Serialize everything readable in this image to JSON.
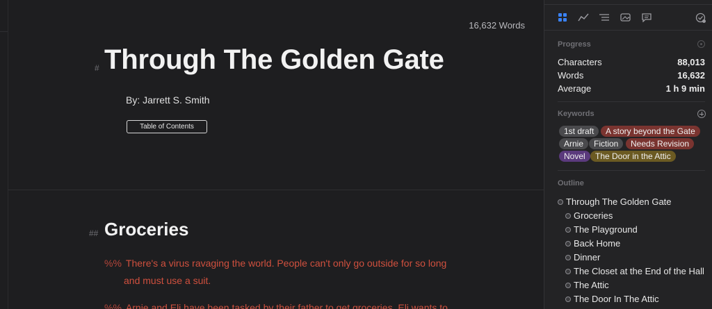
{
  "editor": {
    "word_count": "16,632 Words",
    "h1_marker": "#",
    "title": "Through The Golden Gate",
    "byline": "By: Jarrett S. Smith",
    "toc_button": "Table of Contents",
    "h2_marker": "##",
    "heading2": "Groceries",
    "notes": [
      {
        "marker": "%%",
        "line1": "There's a virus ravaging the world. People can't only go outside for so long",
        "line2": "and must use a suit."
      },
      {
        "marker": "%%",
        "line1": "Arnie and Eli have been tasked by their father to get groceries. Eli wants to"
      }
    ]
  },
  "sidebar": {
    "tabs": [
      "grid-icon",
      "chart-icon",
      "list-icon",
      "images-icon",
      "comment-icon",
      "badge-check-icon"
    ],
    "progress": {
      "title": "Progress",
      "rows": [
        {
          "label": "Characters",
          "value": "88,013"
        },
        {
          "label": "Words",
          "value": "16,632"
        },
        {
          "label": "Average",
          "value": "1 h 9 min"
        }
      ]
    },
    "keywords": {
      "title": "Keywords",
      "tags": [
        {
          "label": "1st draft",
          "color": "#4a4a4d"
        },
        {
          "label": "A story beyond the Gate",
          "color": "#7a3430"
        },
        {
          "label": "Arnie",
          "color": "#4a4a4d"
        },
        {
          "label": "Fiction",
          "color": "#4a4a4d"
        },
        {
          "label": "Needs Revision",
          "color": "#7a3430"
        },
        {
          "label": "Novel",
          "color": "#5b3a7d"
        },
        {
          "label": "The Door in the Attic",
          "color": "#6b5a22"
        }
      ]
    },
    "outline": {
      "title": "Outline",
      "items": [
        "Through The Golden Gate",
        "Groceries",
        "The Playground",
        "Back Home",
        "Dinner",
        "The Closet at the End of the Hall",
        "The Attic",
        "The Door In The Attic"
      ]
    }
  },
  "colors": {
    "accent_blue": "#3a82f7",
    "note_red": "#d0503e"
  }
}
